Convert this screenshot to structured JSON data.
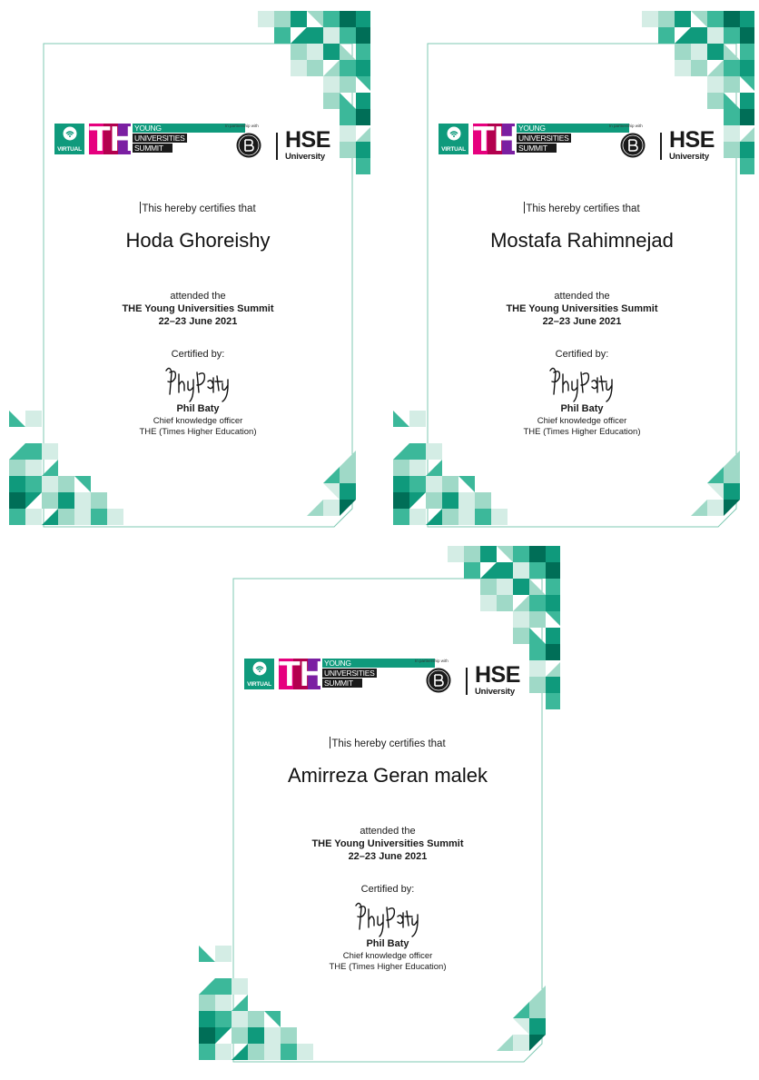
{
  "logo": {
    "virtual": "VIRTUAL",
    "the": "THE",
    "line1": "YOUNG",
    "line2": "UNIVERSITIES",
    "line3": "SUMMIT",
    "partnership": "In partnership with",
    "hse": "HSE",
    "university": "University"
  },
  "certificates": [
    {
      "certifies": "This hereby certifies that",
      "recipient": "Hoda Ghoreishy",
      "attended": "attended the",
      "event": "THE Young Universities Summit",
      "date": "22–23 June 2021",
      "certified_by": "Certified by:",
      "signer_name": "Phil Baty",
      "signer_title": "Chief knowledge officer",
      "signer_org": "THE (Times Higher Education)"
    },
    {
      "certifies": "This hereby certifies that",
      "recipient": "Mostafa Rahimnejad",
      "attended": "attended the",
      "event": "THE Young Universities Summit",
      "date": "22–23 June 2021",
      "certified_by": "Certified by:",
      "signer_name": "Phil Baty",
      "signer_title": "Chief knowledge officer",
      "signer_org": "THE (Times Higher Education)"
    },
    {
      "certifies": "This hereby certifies that",
      "recipient": "Amirreza Geran malek",
      "attended": "attended the",
      "event": "THE Young Universities Summit",
      "date": "22–23 June 2021",
      "certified_by": "Certified by:",
      "signer_name": "Phil Baty",
      "signer_title": "Chief knowledge officer",
      "signer_org": "THE (Times Higher Education)"
    }
  ],
  "colors": {
    "accent_teal": "#0f9a7c",
    "mid_teal": "#3cb89a",
    "light_teal": "#9fd9c7",
    "pale_teal": "#d4ede5",
    "dark_teal": "#006e57",
    "the_pink": "#e6007e",
    "frame_line": "#7fc9b3"
  }
}
